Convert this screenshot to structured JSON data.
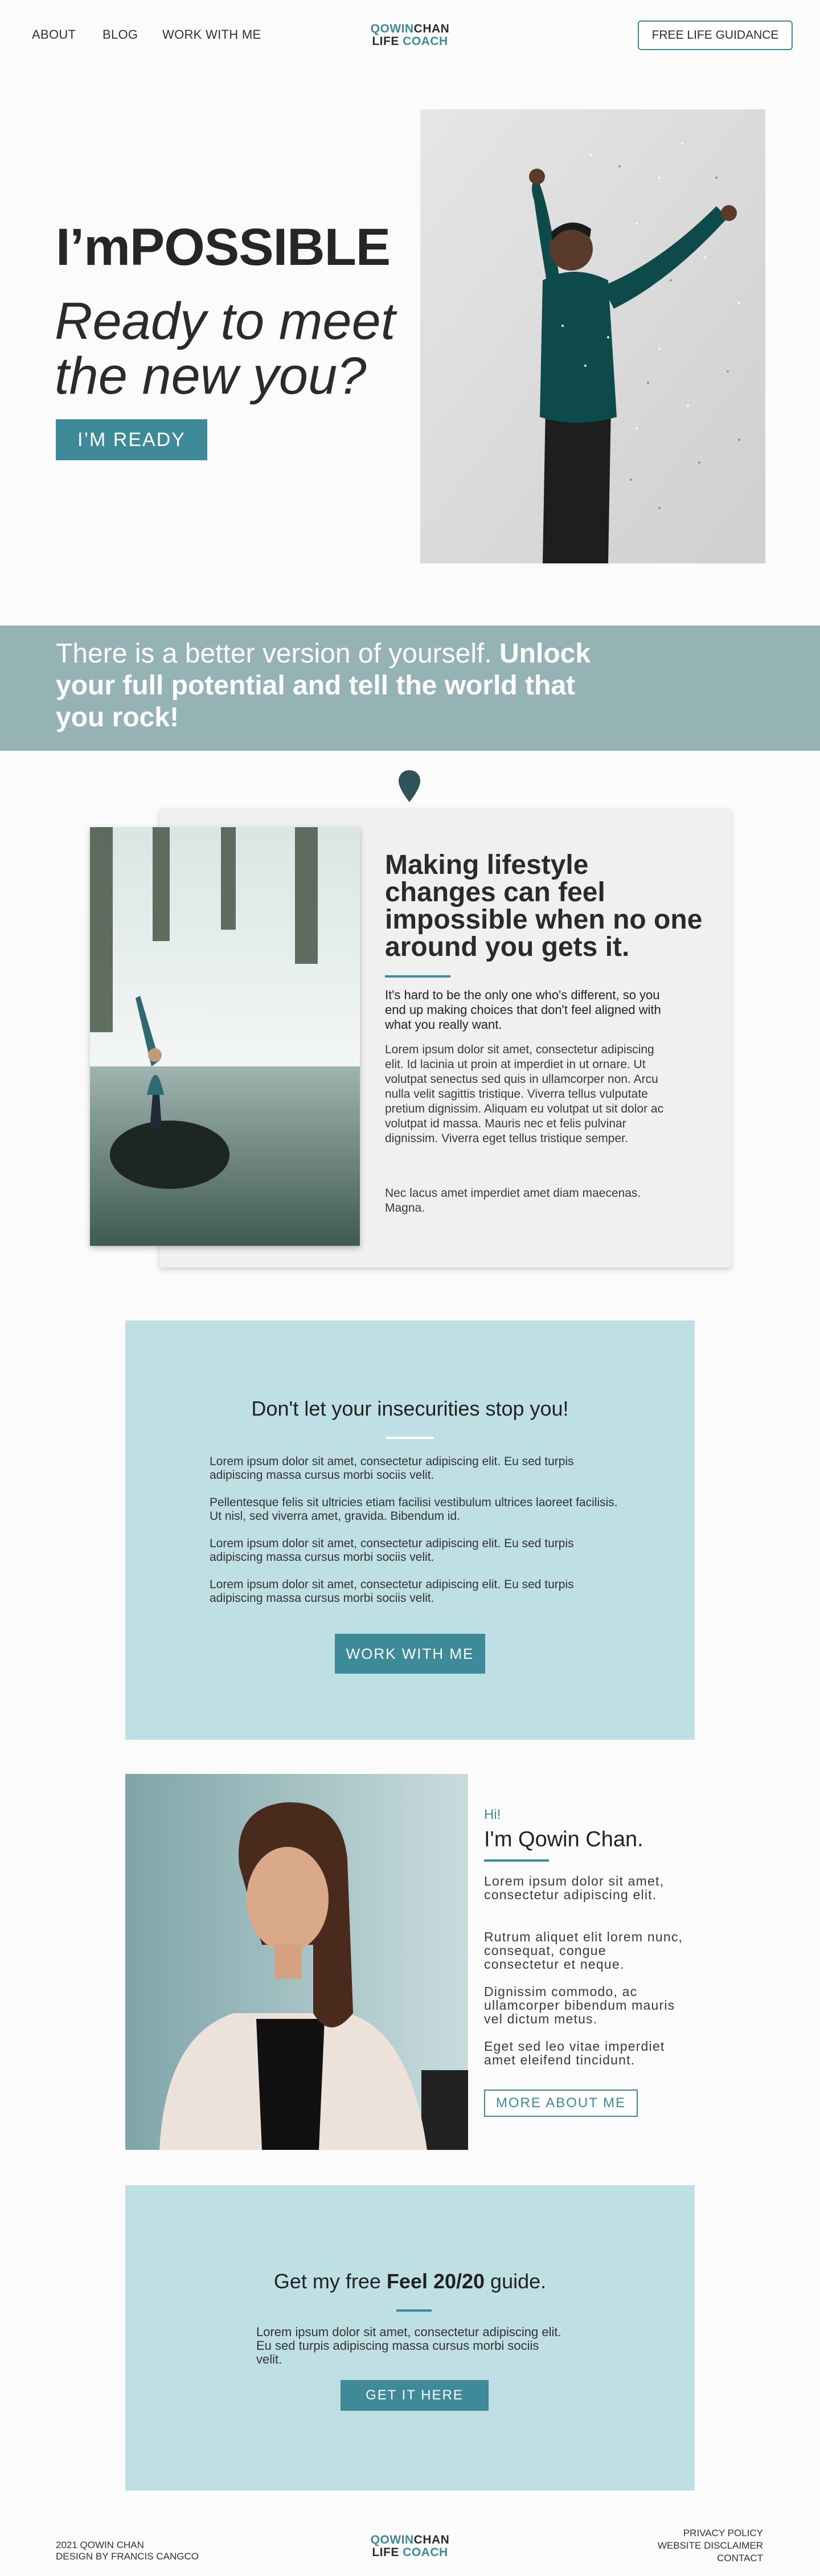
{
  "header": {
    "nav": [
      "ABOUT",
      "BLOG",
      "WORK WITH ME"
    ],
    "logo_line1_a": "QOWIN",
    "logo_line1_b": "CHAN",
    "logo_line2_a": "LIFE ",
    "logo_line2_b": "COACH",
    "cta": "FREE LIFE GUIDANCE"
  },
  "hero": {
    "title": "I’mPOSSIBLE",
    "subtitle": "Ready to meet the new you?",
    "button": "I’M READY"
  },
  "banner": {
    "text_light": "There is  a better version of yourself. ",
    "text_bold": "Unlock your full potential and tell the world that you rock!"
  },
  "lifestyle": {
    "title": "Making lifestyle changes can feel impossible when no one around you gets it.",
    "lead": "It's hard to be the only one who's different, so you end up making choices that don't feel aligned with what you really want.",
    "body": "Lorem ipsum dolor sit amet, consectetur adipiscing elit. Id lacinia ut proin at imperdiet in ut ornare. Ut volutpat senectus sed quis in ullamcorper non. Arcu nulla velit sagittis tristique. Viverra tellus vulputate pretium dignissim. Aliquam eu volutpat ut sit dolor ac volutpat id massa. Mauris nec et felis pulvinar dignissim. Viverra eget tellus tristique semper.",
    "body2": "Nec lacus amet imperdiet amet diam maecenas. Magna."
  },
  "insecurities": {
    "title": "Don't let your insecurities stop you!",
    "paragraphs": [
      "Lorem ipsum dolor sit amet, consectetur adipiscing elit. Eu sed turpis adipiscing massa cursus morbi sociis velit.",
      "Pellentesque felis sit ultricies etiam facilisi vestibulum ultrices laoreet facilisis. Ut nisl, sed viverra amet, gravida. Bibendum id.",
      "Lorem ipsum dolor sit amet, consectetur adipiscing elit. Eu sed turpis adipiscing massa cursus morbi sociis velit.",
      "Lorem ipsum dolor sit amet, consectetur adipiscing elit. Eu sed turpis adipiscing massa cursus morbi sociis velit."
    ],
    "button": "WORK WITH ME"
  },
  "about": {
    "hi": "Hi!",
    "name": "I'm Qowin Chan.",
    "paragraphs": [
      "Lorem ipsum dolor sit amet, consectetur adipiscing elit.",
      "Rutrum aliquet elit lorem nunc, consequat, congue consectetur et neque.",
      "Dignissim commodo, ac ullamcorper bibendum mauris vel dictum metus.",
      "Eget sed leo vitae imperdiet amet eleifend tincidunt."
    ],
    "button": "MORE ABOUT ME"
  },
  "guide": {
    "title_pre": "Get my free ",
    "title_bold": "Feel 20/20",
    "title_post": " guide.",
    "body": "Lorem ipsum dolor sit amet, consectetur adipiscing elit. Eu sed turpis adipiscing massa cursus morbi sociis velit.",
    "button": "GET IT HERE"
  },
  "footer": {
    "copyright": "2021 QOWIN CHAN",
    "credit": "DESIGN BY FRANCIS CANGCO",
    "links": [
      "PRIVACY POLICY",
      "WEBSITE DISCLAIMER",
      "CONTACT"
    ]
  },
  "colors": {
    "accent": "#3e8a98",
    "banner": "#95b2b5",
    "panel": "#bedfe3",
    "card": "#f0f0f0"
  }
}
